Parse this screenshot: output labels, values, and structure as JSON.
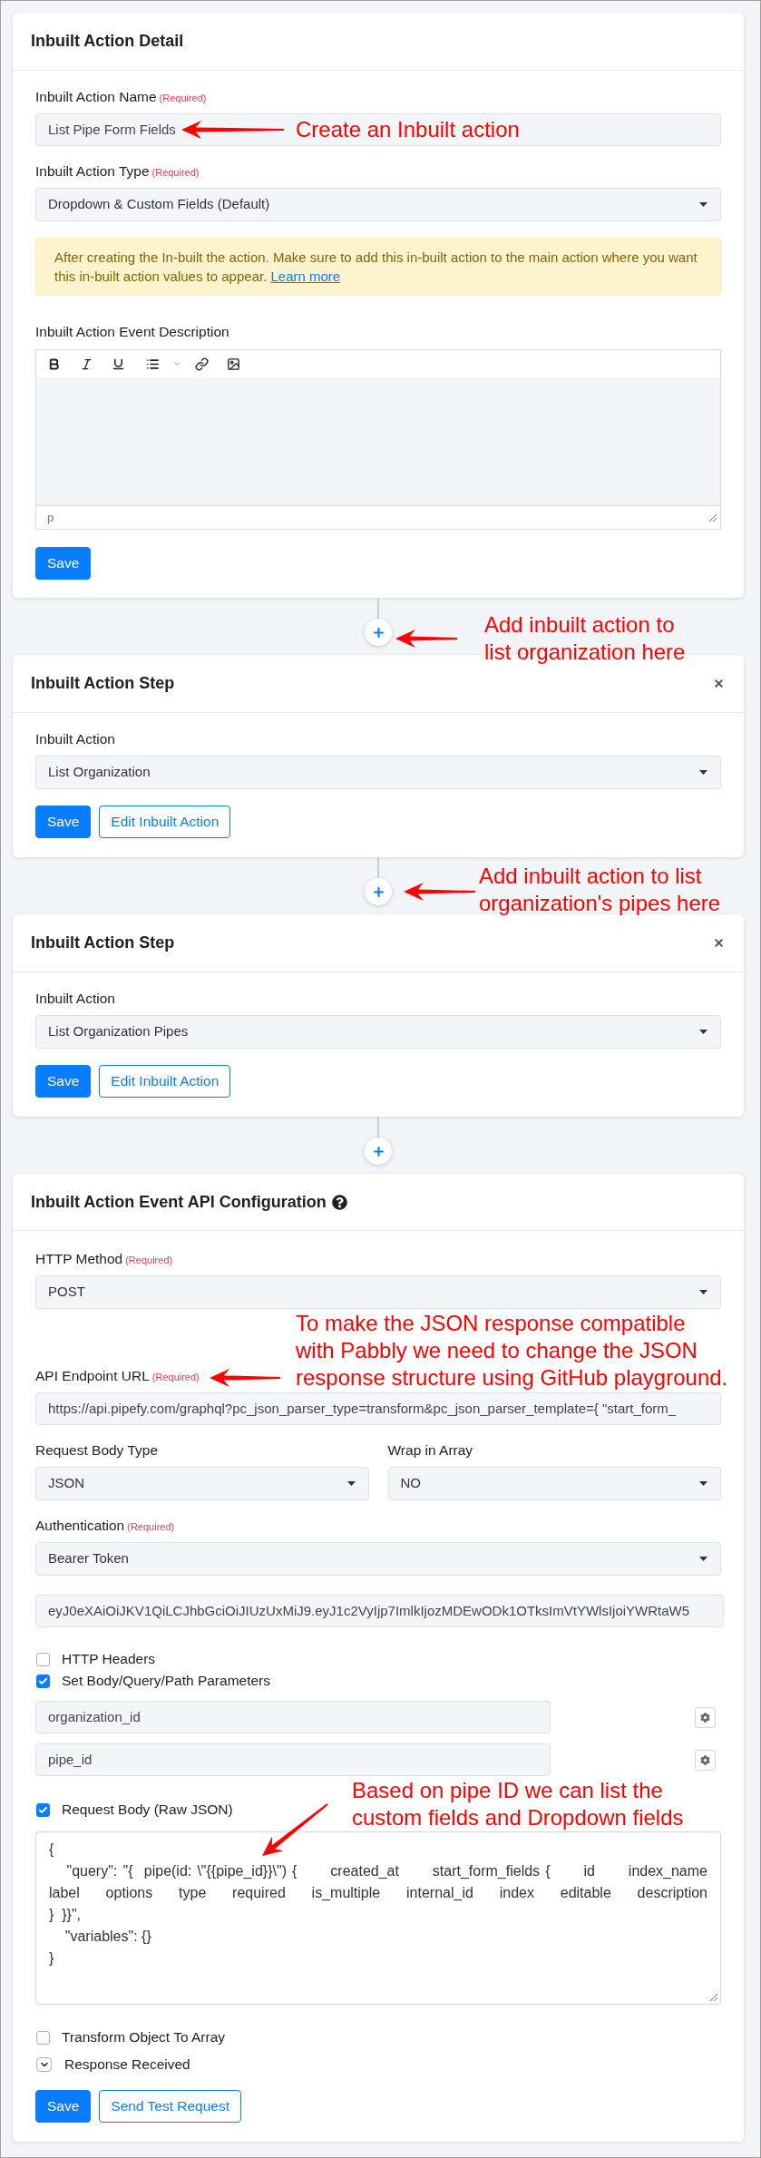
{
  "flow": [
    {
      "kind": "detail",
      "title": "Inbuilt Action Detail",
      "fields": [
        {
          "kind": "text",
          "label": "Inbuilt Action Name",
          "note": "(Required)",
          "value": "List Pipe Form Fields",
          "annotation": "Create an Inbuilt action"
        },
        {
          "kind": "select",
          "label": "Inbuilt Action Type",
          "note": "(Required)",
          "value": "Dropdown & Custom Fields (Default)"
        }
      ],
      "alert": {
        "text": "After creating the In-built the action. Make sure to add this in-built action to the main action where you want this in-built action values to appear.",
        "link": "Learn more"
      },
      "editor": {
        "label": "Inbuilt Action Event Description",
        "status": "p"
      },
      "buttons": [
        {
          "kind": "primary",
          "label": "Save"
        }
      ]
    },
    {
      "kind": "connector",
      "annotation": "Add inbuilt action to\nlist organization here"
    },
    {
      "kind": "step",
      "title": "Inbuilt Action Step",
      "fields": [
        {
          "kind": "select",
          "label": "Inbuilt Action",
          "value": "List Organization"
        }
      ],
      "buttons": [
        {
          "kind": "primary",
          "label": "Save"
        },
        {
          "kind": "outline",
          "label": "Edit Inbuilt Action"
        }
      ]
    },
    {
      "kind": "connector",
      "annotation": "Add inbuilt action to list\norganization's pipes here"
    },
    {
      "kind": "step",
      "title": "Inbuilt Action Step",
      "fields": [
        {
          "kind": "select",
          "label": "Inbuilt Action",
          "value": "List Organization Pipes"
        }
      ],
      "buttons": [
        {
          "kind": "primary",
          "label": "Save"
        },
        {
          "kind": "outline",
          "label": "Edit Inbuilt Action"
        }
      ]
    },
    {
      "kind": "connector"
    },
    {
      "kind": "api",
      "title": "Inbuilt Action Event API Configuration",
      "rows": [
        {
          "kind": "select",
          "label": "HTTP Method",
          "note": "(Required)",
          "value": "POST"
        },
        {
          "kind": "text",
          "label": "API Endpoint URL",
          "note": "(Required)",
          "value": "https://api.pipefy.com/graphql?pc_json_parser_type=transform&pc_json_parser_template={ \"start_form_",
          "annotation": "To make the JSON response compatible\nwith Pabbly we need to change the JSON\nresponse structure using GitHub playground."
        },
        {
          "kind": "pair",
          "fields": [
            {
              "kind": "select",
              "label": "Request Body Type",
              "value": "JSON"
            },
            {
              "kind": "select",
              "label": "Wrap in Array",
              "value": "NO"
            }
          ]
        },
        {
          "kind": "select",
          "label": "Authentication",
          "note": "(Required)",
          "value": "Bearer Token"
        },
        {
          "kind": "token",
          "value": "eyJ0eXAiOiJKV1QiLCJhbGciOiJIUzUxMiJ9.eyJ1c2VyIjp7ImlkIjozMDEwODk1OTksImVtYWlsIjoiYWRtaW5"
        },
        {
          "kind": "checkbox",
          "label": "HTTP Headers",
          "checked": false
        },
        {
          "kind": "checkbox",
          "label": "Set Body/Query/Path Parameters",
          "checked": true
        },
        {
          "kind": "param",
          "value": "organization_id"
        },
        {
          "kind": "param",
          "value": "pipe_id"
        },
        {
          "kind": "checkbox",
          "label": "Request Body (Raw JSON)",
          "checked": true
        },
        {
          "kind": "code",
          "value": "{\n\t\"query\": \"{  pipe(id: \\\"{{pipe_id}}\\\") {      created_at      start_form_fields {      id      index_name      label      options      type      required      is_multiple      internal_id      index      editable      description        }  }}\",\n\t\"variables\": {}\n}",
          "annotation": "Based on pipe ID we can list the\ncustom fields and Dropdown fields"
        },
        {
          "kind": "checkbox",
          "label": "Transform Object To Array",
          "checked": false
        },
        {
          "kind": "toggle",
          "label": "Response Received",
          "expanded": false
        }
      ],
      "buttons": [
        {
          "kind": "primary",
          "label": "Save"
        },
        {
          "kind": "outline",
          "label": "Send Test Request"
        }
      ]
    }
  ]
}
